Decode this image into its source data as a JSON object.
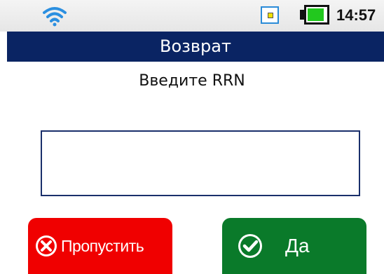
{
  "status_bar": {
    "wifi_icon": "wifi-icon",
    "sim_icon": "sim-card-icon",
    "battery_icon": "battery-icon",
    "battery_level": 0.9,
    "time": "14:57"
  },
  "header": {
    "title": "Возврат"
  },
  "main": {
    "prompt": "Введите RRN",
    "rrn_value": ""
  },
  "buttons": {
    "skip_label": "Пропустить",
    "skip_icon": "cancel-x-icon",
    "yes_label": "Да",
    "yes_icon": "check-icon"
  },
  "colors": {
    "title_bar": "#0a2463",
    "skip_button": "#f00000",
    "yes_button": "#0a7a2a",
    "battery_fill": "#22c81e"
  }
}
